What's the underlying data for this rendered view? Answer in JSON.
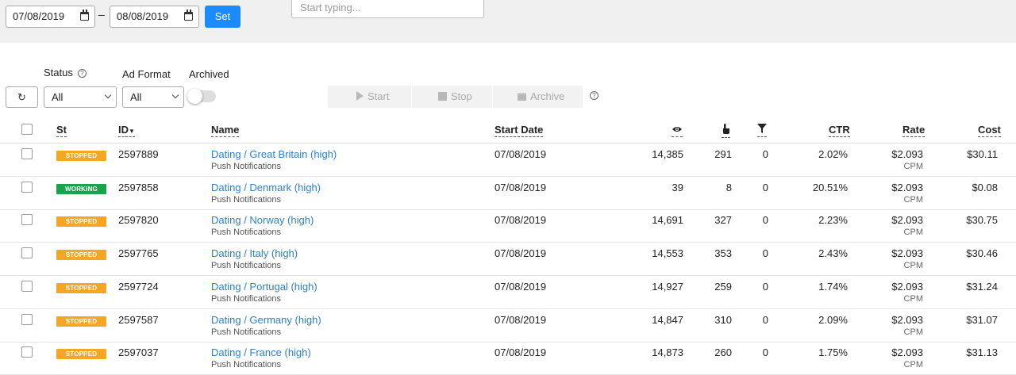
{
  "filters": {
    "date_from": "07/08/2019",
    "date_to": "08/08/2019",
    "date_separator": "–",
    "set_label": "Set",
    "search_placeholder": "Start typing...",
    "status_label": "Status",
    "status_value": "All",
    "ad_format_label": "Ad Format",
    "ad_format_value": "All",
    "archived_label": "Archived",
    "archived_on": false
  },
  "actions": {
    "start_label": "Start",
    "stop_label": "Stop",
    "archive_label": "Archive"
  },
  "columns": {
    "st": "St",
    "id": "ID",
    "name": "Name",
    "start_date": "Start Date",
    "ctr": "CTR",
    "rate": "Rate",
    "cost": "Cost"
  },
  "icons": {
    "impressions": "eye-icon",
    "clicks": "pointer-hand-icon",
    "conversions": "funnel-icon"
  },
  "colors": {
    "stopped": "#f5a623",
    "working": "#1aa34a",
    "link": "#2a7fd4",
    "accent": "#1a8cff"
  },
  "rows": [
    {
      "status": "STOPPED",
      "id": "2597889",
      "name": "Dating / Great Britain (high)",
      "format": "Push Notifications",
      "start_date": "07/08/2019",
      "impressions": "14,385",
      "clicks": "291",
      "conversions": "0",
      "ctr": "2.02%",
      "rate": "$2.093",
      "rate_model": "CPM",
      "cost": "$30.11"
    },
    {
      "status": "WORKING",
      "id": "2597858",
      "name": "Dating / Denmark (high)",
      "format": "Push Notifications",
      "start_date": "07/08/2019",
      "impressions": "39",
      "clicks": "8",
      "conversions": "0",
      "ctr": "20.51%",
      "rate": "$2.093",
      "rate_model": "CPM",
      "cost": "$0.08"
    },
    {
      "status": "STOPPED",
      "id": "2597820",
      "name": "Dating / Norway (high)",
      "format": "Push Notifications",
      "start_date": "07/08/2019",
      "impressions": "14,691",
      "clicks": "327",
      "conversions": "0",
      "ctr": "2.23%",
      "rate": "$2.093",
      "rate_model": "CPM",
      "cost": "$30.75"
    },
    {
      "status": "STOPPED",
      "id": "2597765",
      "name": "Dating / Italy (high)",
      "format": "Push Notifications",
      "start_date": "07/08/2019",
      "impressions": "14,553",
      "clicks": "353",
      "conversions": "0",
      "ctr": "2.43%",
      "rate": "$2.093",
      "rate_model": "CPM",
      "cost": "$30.46"
    },
    {
      "status": "STOPPED",
      "id": "2597724",
      "name": "Dating / Portugal (high)",
      "format": "Push Notifications",
      "start_date": "07/08/2019",
      "impressions": "14,927",
      "clicks": "259",
      "conversions": "0",
      "ctr": "1.74%",
      "rate": "$2.093",
      "rate_model": "CPM",
      "cost": "$31.24"
    },
    {
      "status": "STOPPED",
      "id": "2597587",
      "name": "Dating / Germany (high)",
      "format": "Push Notifications",
      "start_date": "07/08/2019",
      "impressions": "14,847",
      "clicks": "310",
      "conversions": "0",
      "ctr": "2.09%",
      "rate": "$2.093",
      "rate_model": "CPM",
      "cost": "$31.07"
    },
    {
      "status": "STOPPED",
      "id": "2597037",
      "name": "Dating / France (high)",
      "format": "Push Notifications",
      "start_date": "07/08/2019",
      "impressions": "14,873",
      "clicks": "260",
      "conversions": "0",
      "ctr": "1.75%",
      "rate": "$2.093",
      "rate_model": "CPM",
      "cost": "$31.13"
    }
  ]
}
